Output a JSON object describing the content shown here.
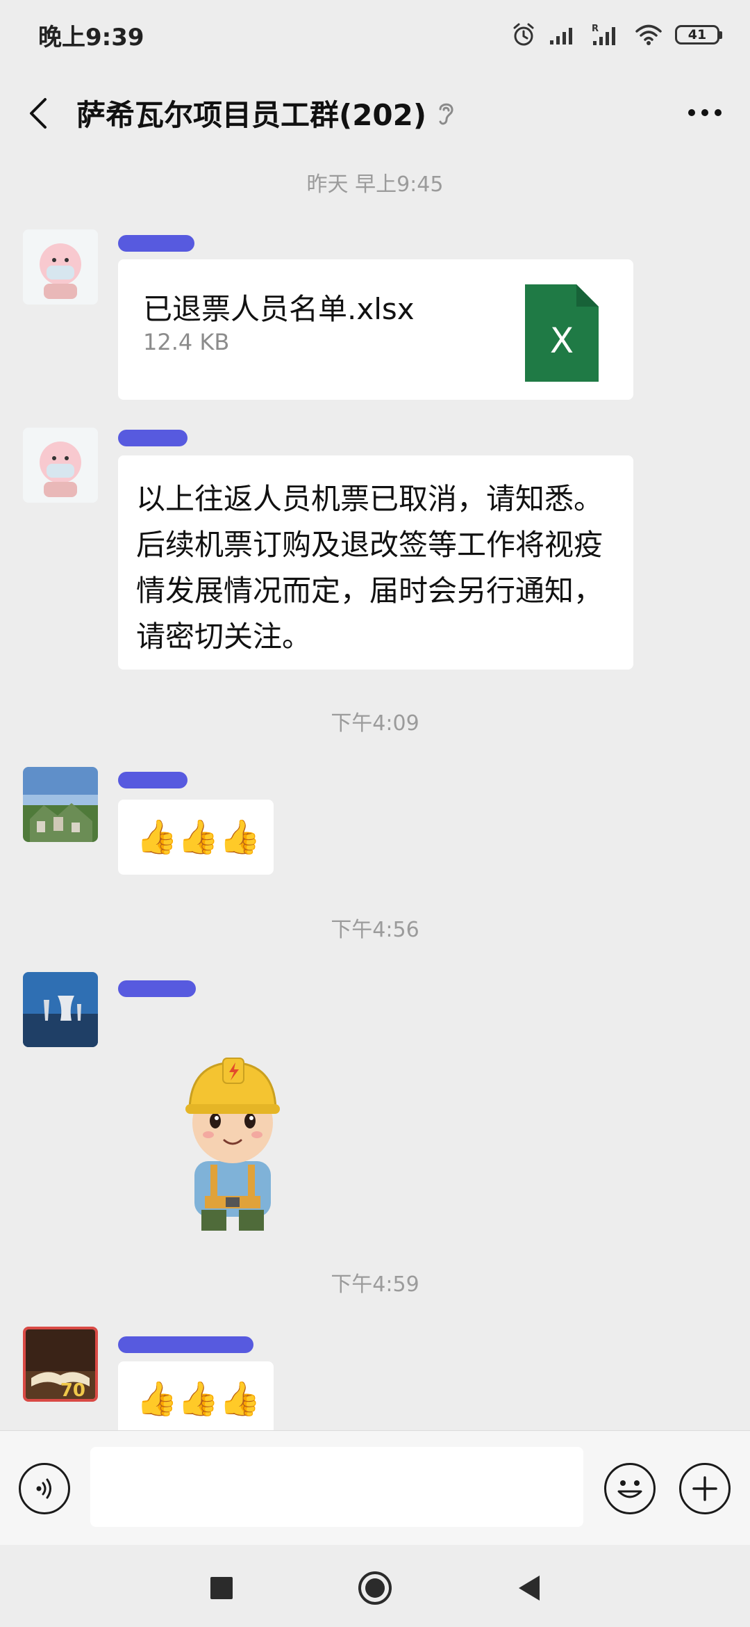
{
  "status_bar": {
    "time": "晚上9:39",
    "battery_level": "41"
  },
  "header": {
    "title": "萨希瓦尔项目员工群(202)"
  },
  "timestamps": {
    "t1": "昨天 早上9:45",
    "t2": "下午4:09",
    "t3": "下午4:56",
    "t4": "下午4:59"
  },
  "messages": [
    {
      "type": "file",
      "file_name": "已退票人员名单.xlsx",
      "file_size": "12.4 KB",
      "file_icon_letter": "X"
    },
    {
      "type": "text",
      "text": "以上往返人员机票已取消，请知悉。后续机票订购及退改签等工作将视疫情发展情况而定，届时会另行通知，请密切关注。"
    },
    {
      "type": "emoji",
      "text": "👍👍👍"
    },
    {
      "type": "sticker",
      "sticker_name": "construction-worker-sticker"
    },
    {
      "type": "emoji",
      "text": "👍👍👍"
    }
  ],
  "input": {
    "placeholder": ""
  },
  "colors": {
    "background": "#ededed",
    "bubble": "#ffffff",
    "excel_green": "#1f7a45",
    "timestamp_text": "#9b9b9b",
    "redaction": "#3c3fdc"
  }
}
